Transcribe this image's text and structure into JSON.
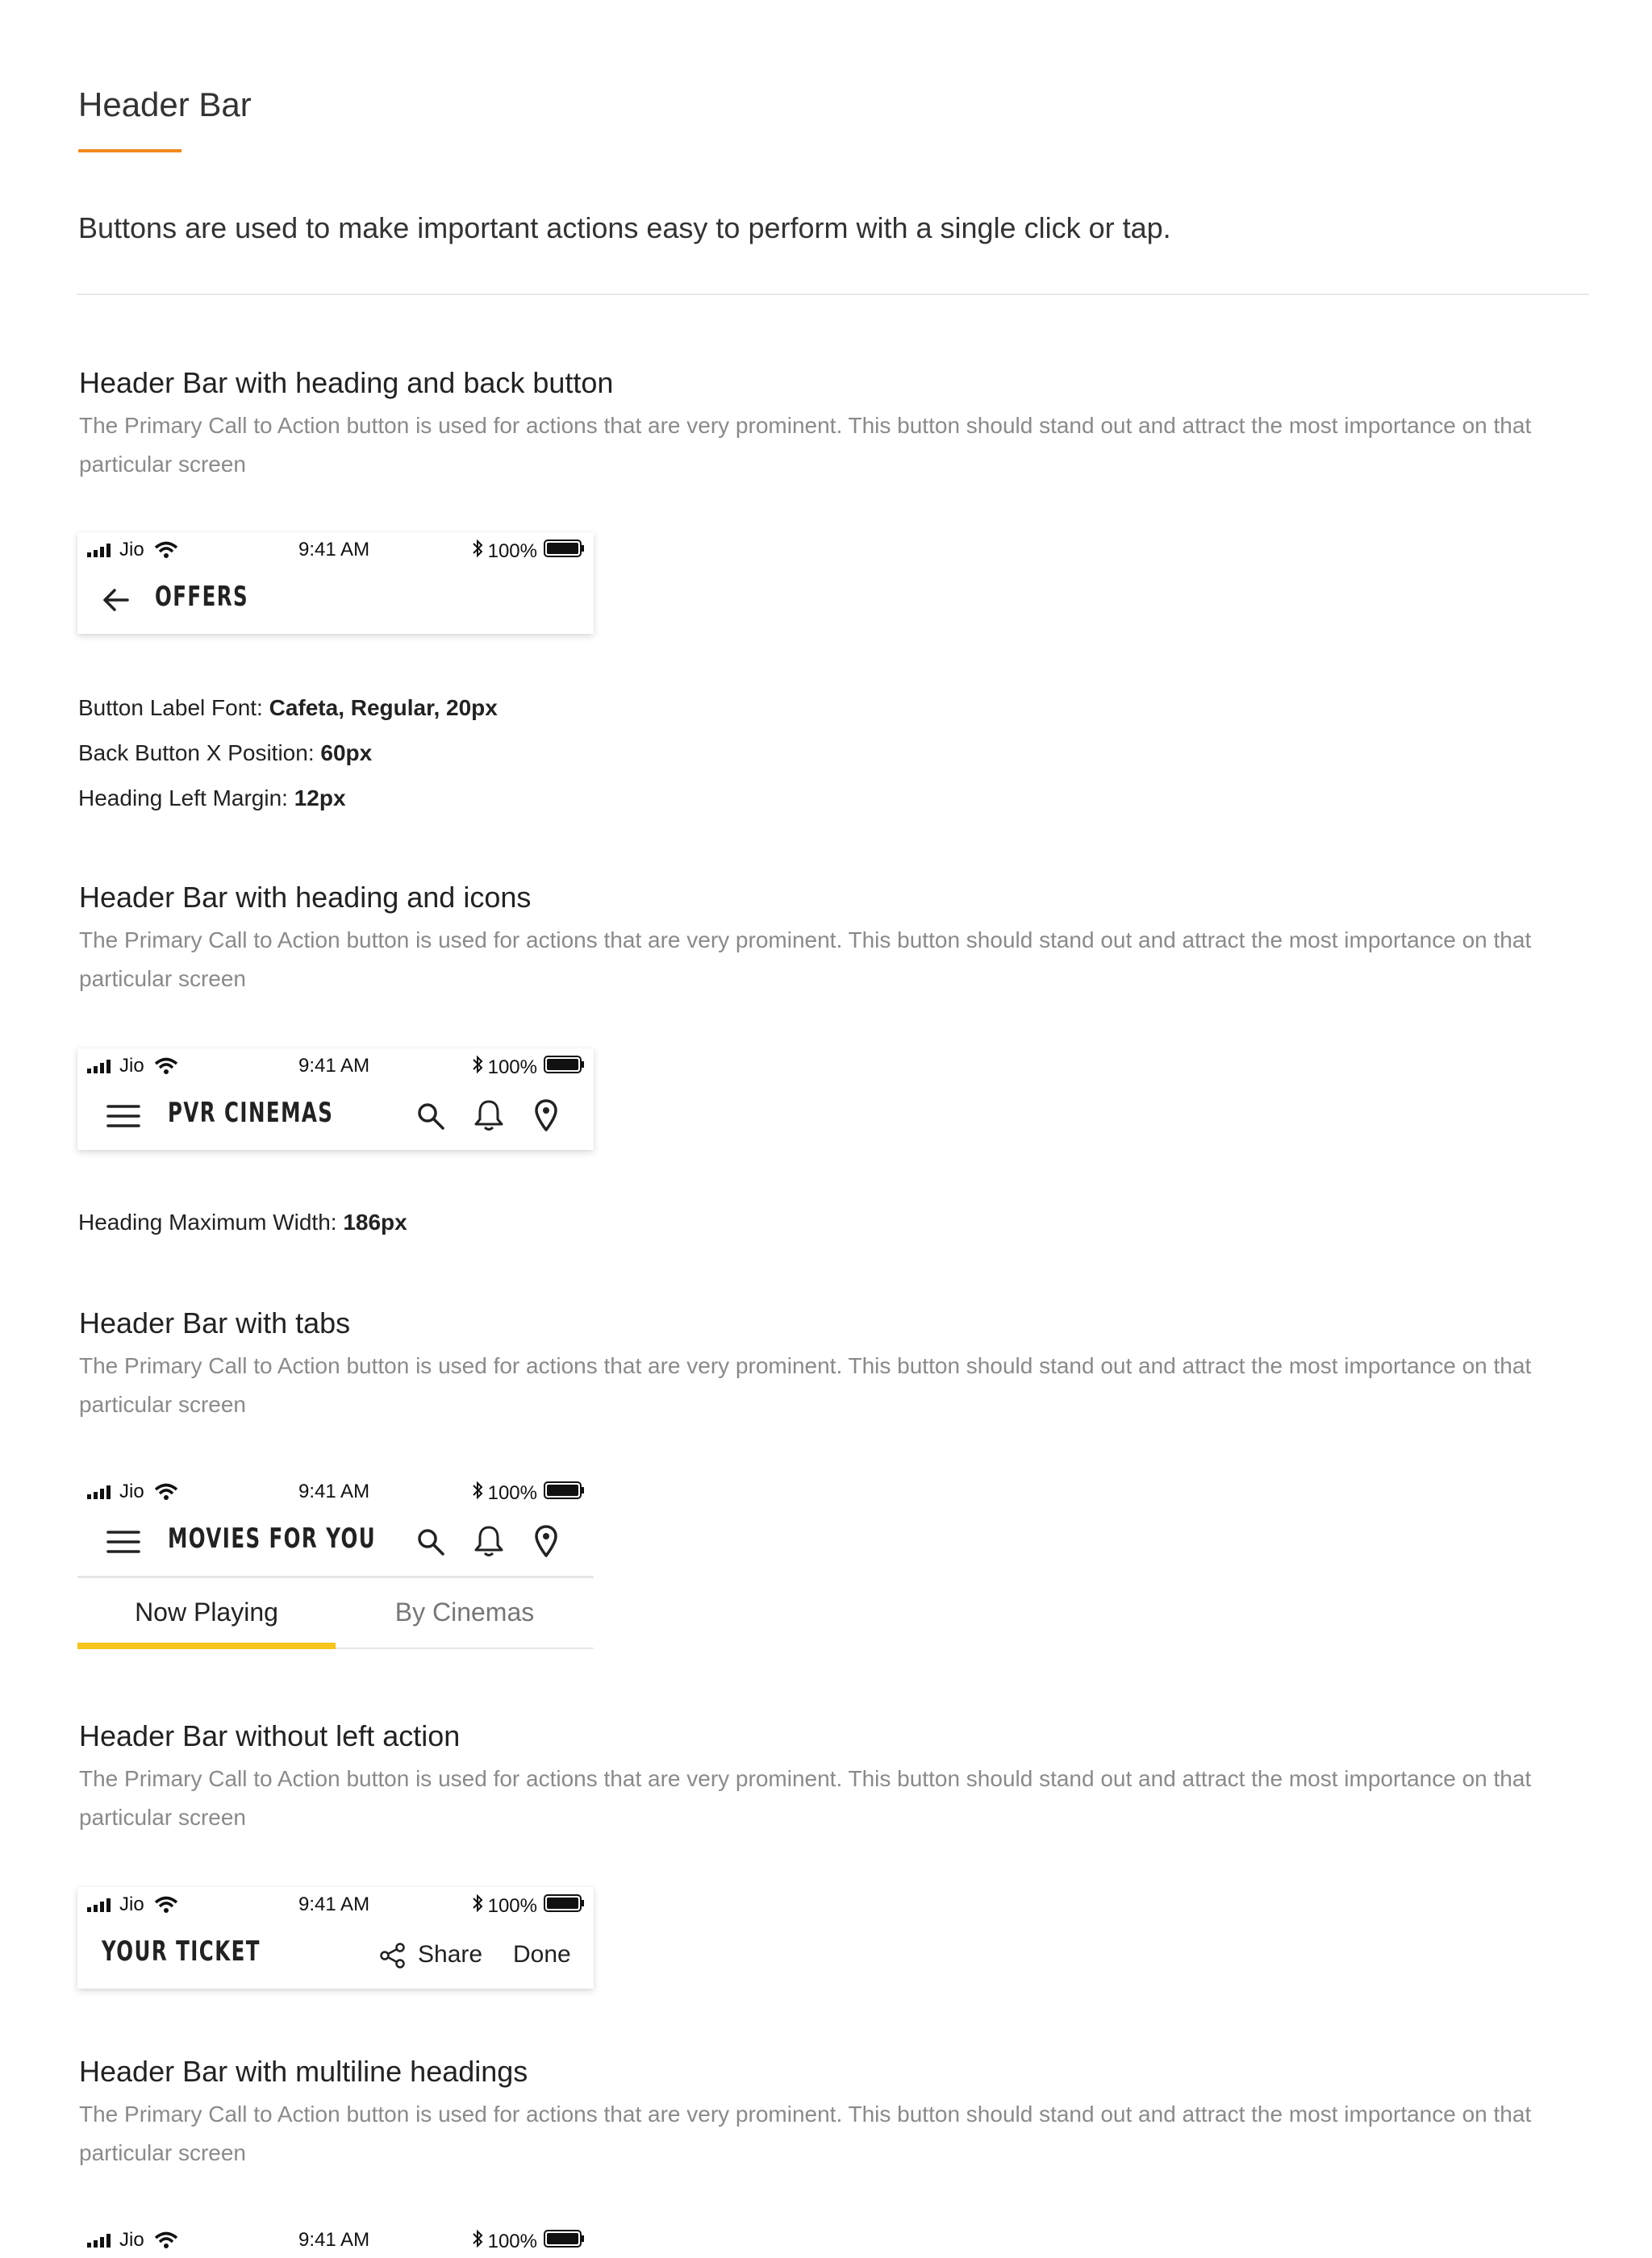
{
  "page": {
    "title": "Header Bar",
    "lead": "Buttons are used to make important actions easy to perform with a single click or tap."
  },
  "colors": {
    "accent_underline": "#f08a1c",
    "tab_indicator": "#f6c41a",
    "description_text": "#8a8a8a"
  },
  "status_bar": {
    "carrier": "Jio",
    "time": "9:41 AM",
    "battery": "100%"
  },
  "sections": [
    {
      "title": "Header Bar with heading and back button",
      "description": "The Primary Call to Action button is used for actions that are very prominent. This button should stand out and attract the most importance on that particular screen",
      "heading": "OFFERS",
      "specs": [
        {
          "label": "Button Label Font: ",
          "value": "Cafeta, Regular, 20px"
        },
        {
          "label": "Back Button X Position: ",
          "value": "60px"
        },
        {
          "label": "Heading Left Margin: ",
          "value": "12px"
        }
      ]
    },
    {
      "title": "Header Bar with heading and icons",
      "description": "The Primary Call to Action button is used for actions that are very prominent. This button should stand out and attract the most importance on that particular screen",
      "heading": "PVR CINEMAS",
      "specs": [
        {
          "label": "Heading Maximum Width: ",
          "value": "186px"
        }
      ]
    },
    {
      "title": "Header Bar with tabs",
      "description": "The Primary Call to Action button is used for actions that are very prominent. This button should stand out and attract the most importance on that particular screen",
      "heading": "MOVIES FOR YOU",
      "tabs": [
        {
          "label": "Now Playing",
          "active": true
        },
        {
          "label": "By Cinemas",
          "active": false
        }
      ]
    },
    {
      "title": "Header Bar without left action",
      "description": "The Primary Call to Action button is used for actions that are very prominent. This button should stand out and attract the most importance on that particular screen",
      "heading": "YOUR TICKET",
      "share_label": "Share",
      "done_label": "Done"
    },
    {
      "title": "Header Bar with multiline headings",
      "description": "The Primary Call to Action button is used for actions that are very prominent. This button should stand out and attract the most importance on that particular screen"
    }
  ],
  "icons": {
    "back": "arrow-left-icon",
    "menu": "hamburger-menu-icon",
    "search": "search-icon",
    "notifications": "bell-icon",
    "location": "location-pin-icon",
    "share": "share-icon",
    "signal": "signal-bars-icon",
    "wifi": "wifi-icon",
    "bluetooth": "bluetooth-icon",
    "battery": "battery-icon"
  }
}
